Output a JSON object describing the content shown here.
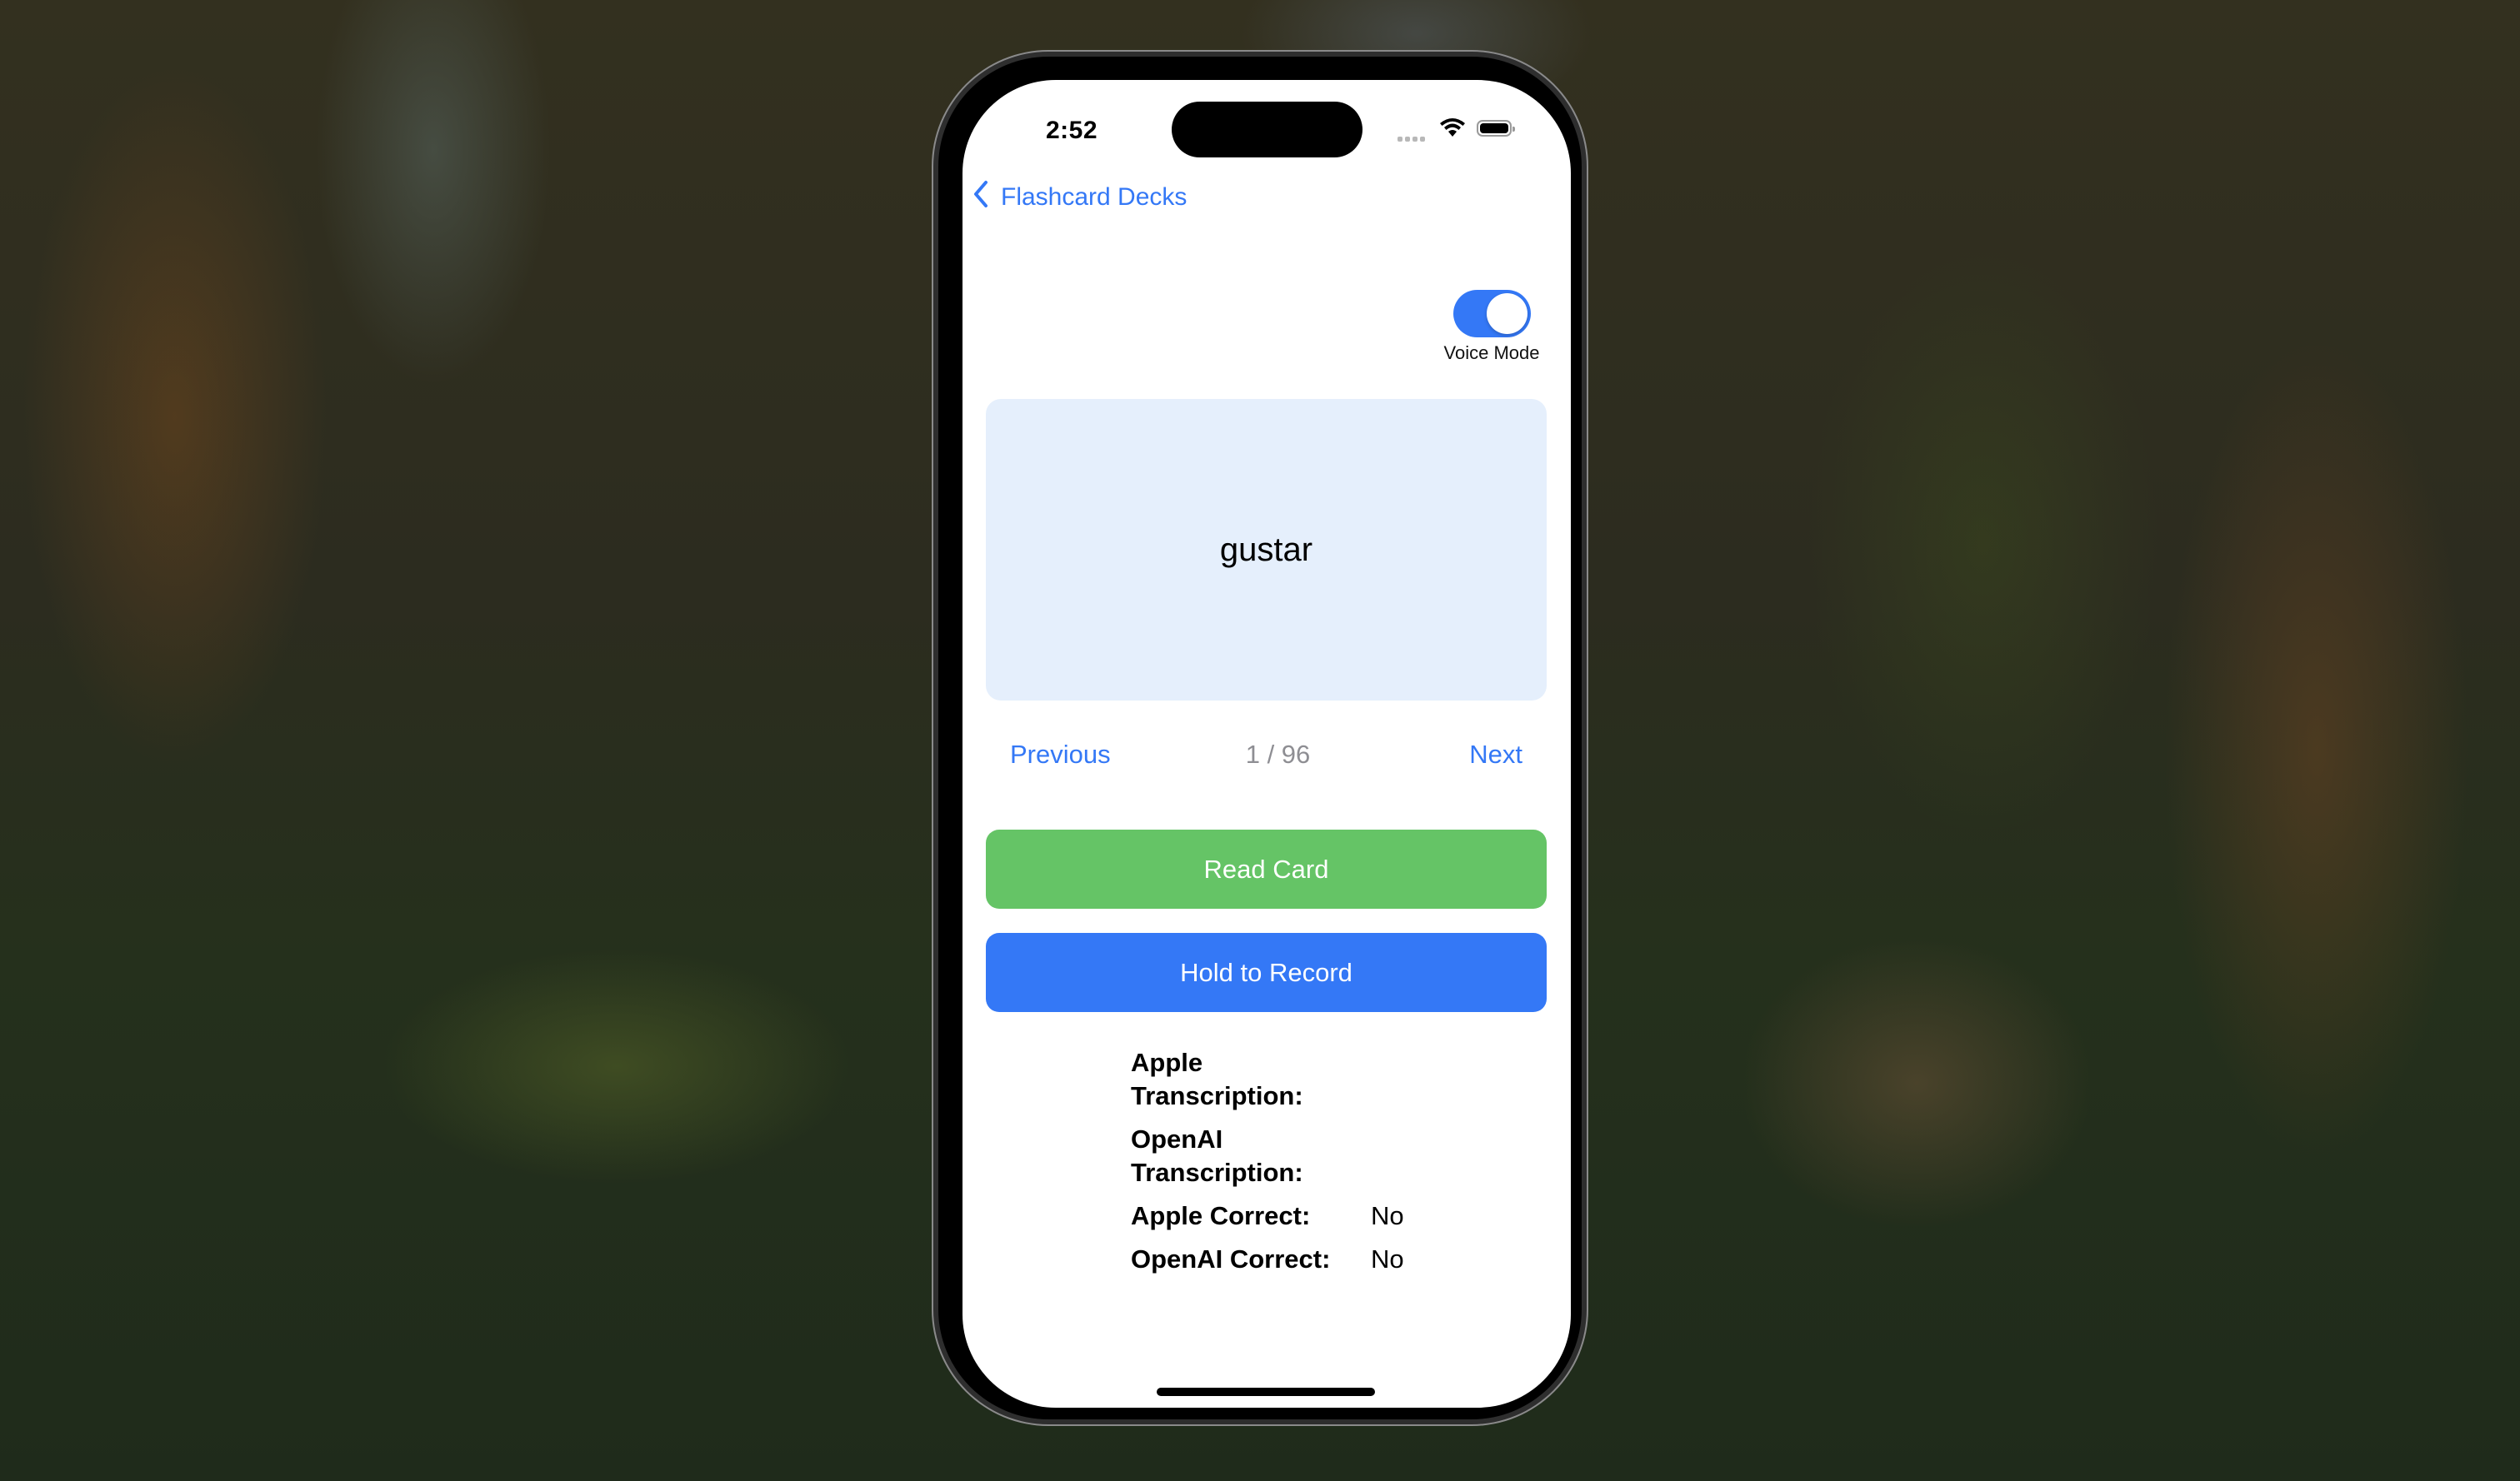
{
  "status_bar": {
    "time": "2:52",
    "icons": [
      "signal-dots-icon",
      "wifi-icon",
      "battery-icon"
    ]
  },
  "navigation": {
    "back_label": "Flashcard Decks",
    "back_icon": "chevron-left-icon"
  },
  "voice_mode": {
    "label": "Voice Mode",
    "enabled": true
  },
  "card": {
    "word": "gustar"
  },
  "pager": {
    "previous_label": "Previous",
    "count": "1 / 96",
    "next_label": "Next"
  },
  "actions": {
    "read_label": "Read Card",
    "record_label": "Hold to Record"
  },
  "results": [
    {
      "label": "Apple Transcription:",
      "value": ""
    },
    {
      "label": "OpenAI Transcription:",
      "value": ""
    },
    {
      "label": "Apple Correct:",
      "value": "No"
    },
    {
      "label": "OpenAI Correct:",
      "value": "No"
    }
  ],
  "colors": {
    "accent_blue": "#3478f6",
    "read_green": "#65c466",
    "card_bg": "#e5effc",
    "counter_gray": "#8e8e93"
  }
}
